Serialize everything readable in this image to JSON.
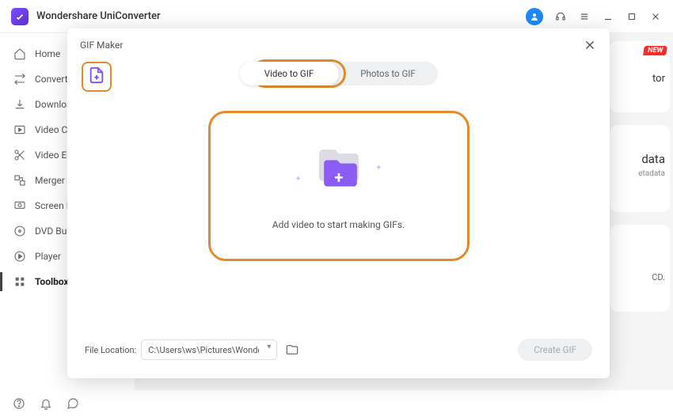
{
  "app": {
    "title": "Wondershare UniConverter"
  },
  "sidebar": {
    "items": [
      {
        "label": "Home"
      },
      {
        "label": "Converter"
      },
      {
        "label": "Downloader"
      },
      {
        "label": "Video Compressor"
      },
      {
        "label": "Video Editor"
      },
      {
        "label": "Merger"
      },
      {
        "label": "Screen Recorder"
      },
      {
        "label": "DVD Burner"
      },
      {
        "label": "Player"
      },
      {
        "label": "Toolbox"
      }
    ]
  },
  "peek": {
    "new": "NEW",
    "card1_suffix": "tor",
    "card2a": "data",
    "card2b": "etadata",
    "card3": "CD."
  },
  "modal": {
    "title": "GIF Maker",
    "tab_video": "Video to GIF",
    "tab_photos": "Photos to GIF",
    "drop_text": "Add video to start making GIFs.",
    "file_location_label": "File Location:",
    "file_location_value": "C:\\Users\\ws\\Pictures\\Wonders",
    "create_btn": "Create GIF"
  }
}
